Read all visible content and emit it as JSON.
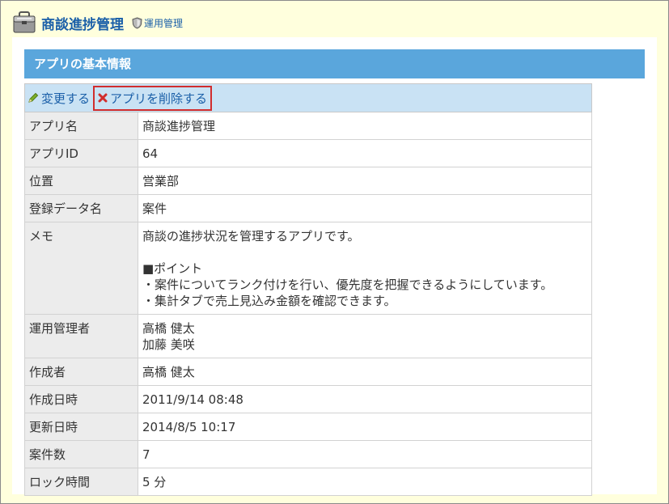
{
  "header": {
    "app_title": "商談進捗管理",
    "admin_link": "運用管理",
    "colors": {
      "title": "#1a5fa8",
      "background": "#ffffdd"
    },
    "icons": {
      "app": "briefcase-icon",
      "admin": "shield-icon"
    }
  },
  "section": {
    "title": "アプリの基本情報",
    "colors": {
      "header_bg": "#5aa6dc",
      "toolbar_bg": "#c9e2f4"
    }
  },
  "toolbar": {
    "edit_label": "変更する",
    "delete_label": "アプリを削除する",
    "icons": {
      "edit": "pencil-icon",
      "delete": "close-icon"
    },
    "colors": {
      "delete_highlight": "#d12d2d"
    }
  },
  "rows": {
    "app_name": {
      "label": "アプリ名",
      "value": "商談進捗管理"
    },
    "app_id": {
      "label": "アプリID",
      "value": "64"
    },
    "location": {
      "label": "位置",
      "value": "営業部"
    },
    "data_name": {
      "label": "登録データ名",
      "value": "案件"
    },
    "memo": {
      "label": "メモ",
      "lines": [
        "商談の進捗状況を管理するアプリです。",
        "",
        "■ポイント",
        "・案件についてランク付けを行い、優先度を把握できるようにしています。",
        "・集計タブで売上見込み金額を確認できます。"
      ]
    },
    "admins": {
      "label": "運用管理者",
      "values": [
        "高橋 健太",
        "加藤 美咲"
      ]
    },
    "creator": {
      "label": "作成者",
      "value": "高橋 健太"
    },
    "created_at": {
      "label": "作成日時",
      "value": "2011/9/14 08:48"
    },
    "updated_at": {
      "label": "更新日時",
      "value": "2014/8/5 10:17"
    },
    "record_count": {
      "label": "案件数",
      "value": "7"
    },
    "lock_time": {
      "label": "ロック時間",
      "value": "5 分"
    }
  }
}
